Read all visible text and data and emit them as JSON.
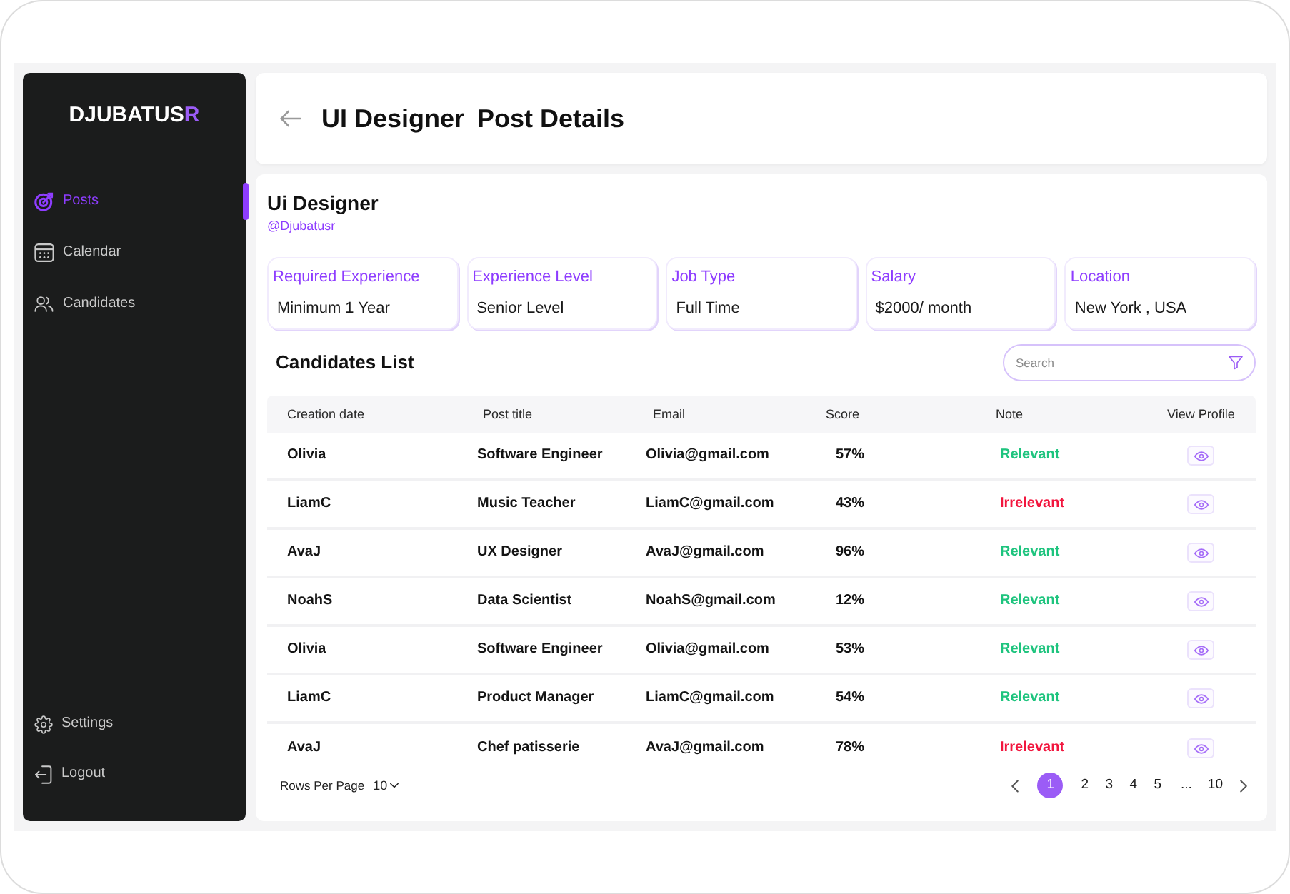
{
  "sidebar": {
    "logo": {
      "text": "DJUBATUS",
      "accent": "R"
    },
    "items": [
      {
        "label": "Posts",
        "selected": true
      },
      {
        "label": "Calendar",
        "selected": false
      },
      {
        "label": "Candidates",
        "selected": false
      }
    ],
    "footer_items": [
      {
        "label": "Settings"
      },
      {
        "label": "Logout"
      }
    ]
  },
  "header": {
    "title": "UI Designer",
    "subtitle": "Post Details"
  },
  "post": {
    "title": "Ui Designer",
    "handle": "@Djubatusr",
    "details": [
      {
        "label": "Required Experience",
        "value": "Minimum 1 Year"
      },
      {
        "label": "Experience Level",
        "value": "Senior Level"
      },
      {
        "label": "Job Type",
        "value": "Full Time"
      },
      {
        "label": "Salary",
        "value": "$2000/ month"
      },
      {
        "label": "Location",
        "value": "New York , USA"
      }
    ]
  },
  "candidates": {
    "title": "Candidates List",
    "search": {
      "placeholder": "Search"
    },
    "columns": [
      "Creation date",
      "Post title",
      "Email",
      "Score",
      "Note",
      "View Profile"
    ],
    "rows": [
      {
        "creation_date": "Olivia",
        "post_title": "Software Engineer",
        "email": "Olivia@gmail.com",
        "score": "57%",
        "note": "Relevant",
        "color": "#1ec47e"
      },
      {
        "creation_date": "LiamC",
        "post_title": "Music Teacher",
        "email": "LiamC@gmail.com",
        "score": "43%",
        "note": "Irrelevant",
        "color": "#f2163e"
      },
      {
        "creation_date": "AvaJ",
        "post_title": "UX Designer",
        "email": "AvaJ@gmail.com",
        "score": "96%",
        "note": "Relevant",
        "color": "#1ec47e"
      },
      {
        "creation_date": "NoahS",
        "post_title": "Data Scientist",
        "email": "NoahS@gmail.com",
        "score": "12%",
        "note": "Relevant",
        "color": "#1ec47e"
      },
      {
        "creation_date": "Olivia",
        "post_title": "Software Engineer",
        "email": "Olivia@gmail.com",
        "score": "53%",
        "note": "Relevant",
        "color": "#1ec47e"
      },
      {
        "creation_date": "LiamC",
        "post_title": "Product Manager",
        "email": "LiamC@gmail.com",
        "score": "54%",
        "note": "Relevant",
        "color": "#1ec47e"
      },
      {
        "creation_date": "AvaJ",
        "post_title": "Chef patisserie",
        "email": "AvaJ@gmail.com",
        "score": "78%",
        "note": "Irrelevant",
        "color": "#f2163e"
      }
    ]
  },
  "pagination": {
    "label": "Rows Per Page",
    "rows_per_page": "10",
    "pages": [
      {
        "kind": "page",
        "label": "1",
        "selected": true
      },
      {
        "kind": "page",
        "label": "2",
        "selected": false
      },
      {
        "kind": "page",
        "label": "3",
        "selected": false
      },
      {
        "kind": "page",
        "label": "4",
        "selected": false
      },
      {
        "kind": "page",
        "label": "5",
        "selected": false
      },
      {
        "kind": "gap",
        "label": "...",
        "selected": false
      },
      {
        "kind": "page",
        "label": "10",
        "selected": false
      }
    ]
  }
}
